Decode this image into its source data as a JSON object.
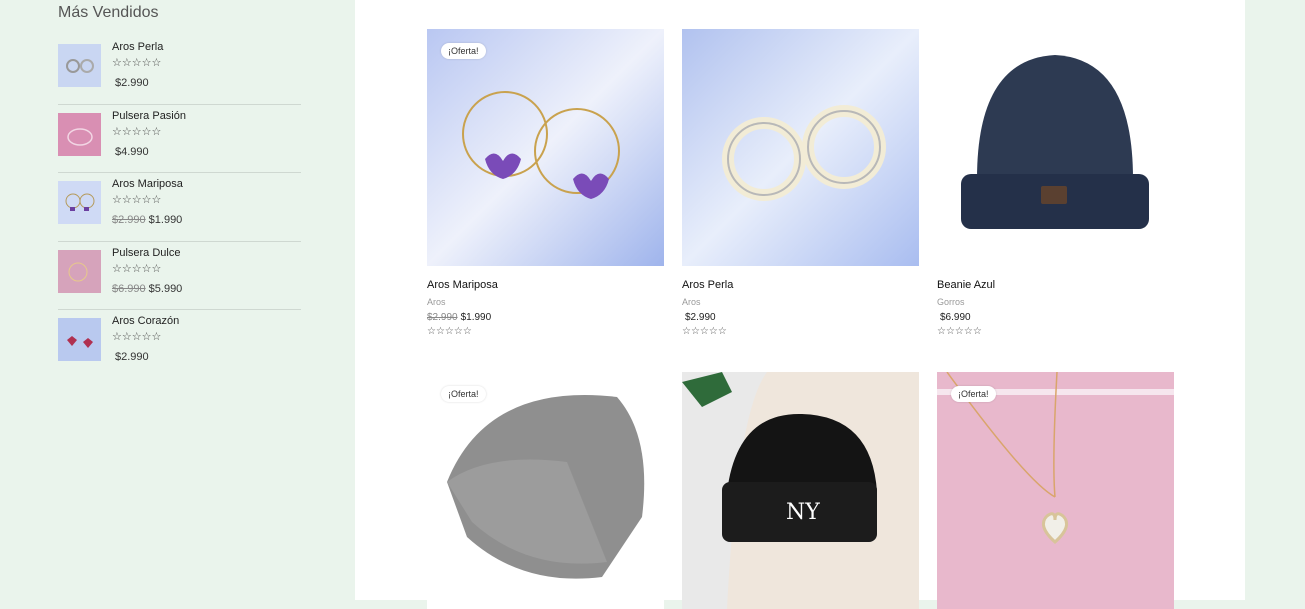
{
  "sidebar": {
    "title": "Más Vendidos",
    "items": [
      {
        "name": "Aros Perla",
        "stars": "☆☆☆☆☆",
        "old_price": "",
        "price": "$2.990"
      },
      {
        "name": "Pulsera Pasión",
        "stars": "☆☆☆☆☆",
        "old_price": "",
        "price": "$4.990"
      },
      {
        "name": "Aros Mariposa",
        "stars": "☆☆☆☆☆",
        "old_price": "$2.990",
        "price": "$1.990"
      },
      {
        "name": "Pulsera Dulce",
        "stars": "☆☆☆☆☆",
        "old_price": "$6.990",
        "price": "$5.990"
      },
      {
        "name": "Aros Corazón",
        "stars": "☆☆☆☆☆",
        "old_price": "",
        "price": "$2.990"
      }
    ]
  },
  "products": [
    {
      "badge": "¡Oferta!",
      "name": "Aros Mariposa",
      "category": "Aros",
      "old_price": "$2.990",
      "price": "$1.990",
      "stars": "☆☆☆☆☆"
    },
    {
      "badge": "",
      "name": "Aros Perla",
      "category": "Aros",
      "old_price": "",
      "price": "$2.990",
      "stars": "☆☆☆☆☆"
    },
    {
      "badge": "",
      "name": "Beanie Azul",
      "category": "Gorros",
      "old_price": "",
      "price": "$6.990",
      "stars": "☆☆☆☆☆"
    },
    {
      "badge": "¡Oferta!",
      "name": "",
      "category": "",
      "old_price": "",
      "price": "",
      "stars": ""
    },
    {
      "badge": "",
      "name": "",
      "category": "",
      "old_price": "",
      "price": "",
      "stars": ""
    },
    {
      "badge": "¡Oferta!",
      "name": "",
      "category": "",
      "old_price": "",
      "price": "",
      "stars": ""
    }
  ]
}
